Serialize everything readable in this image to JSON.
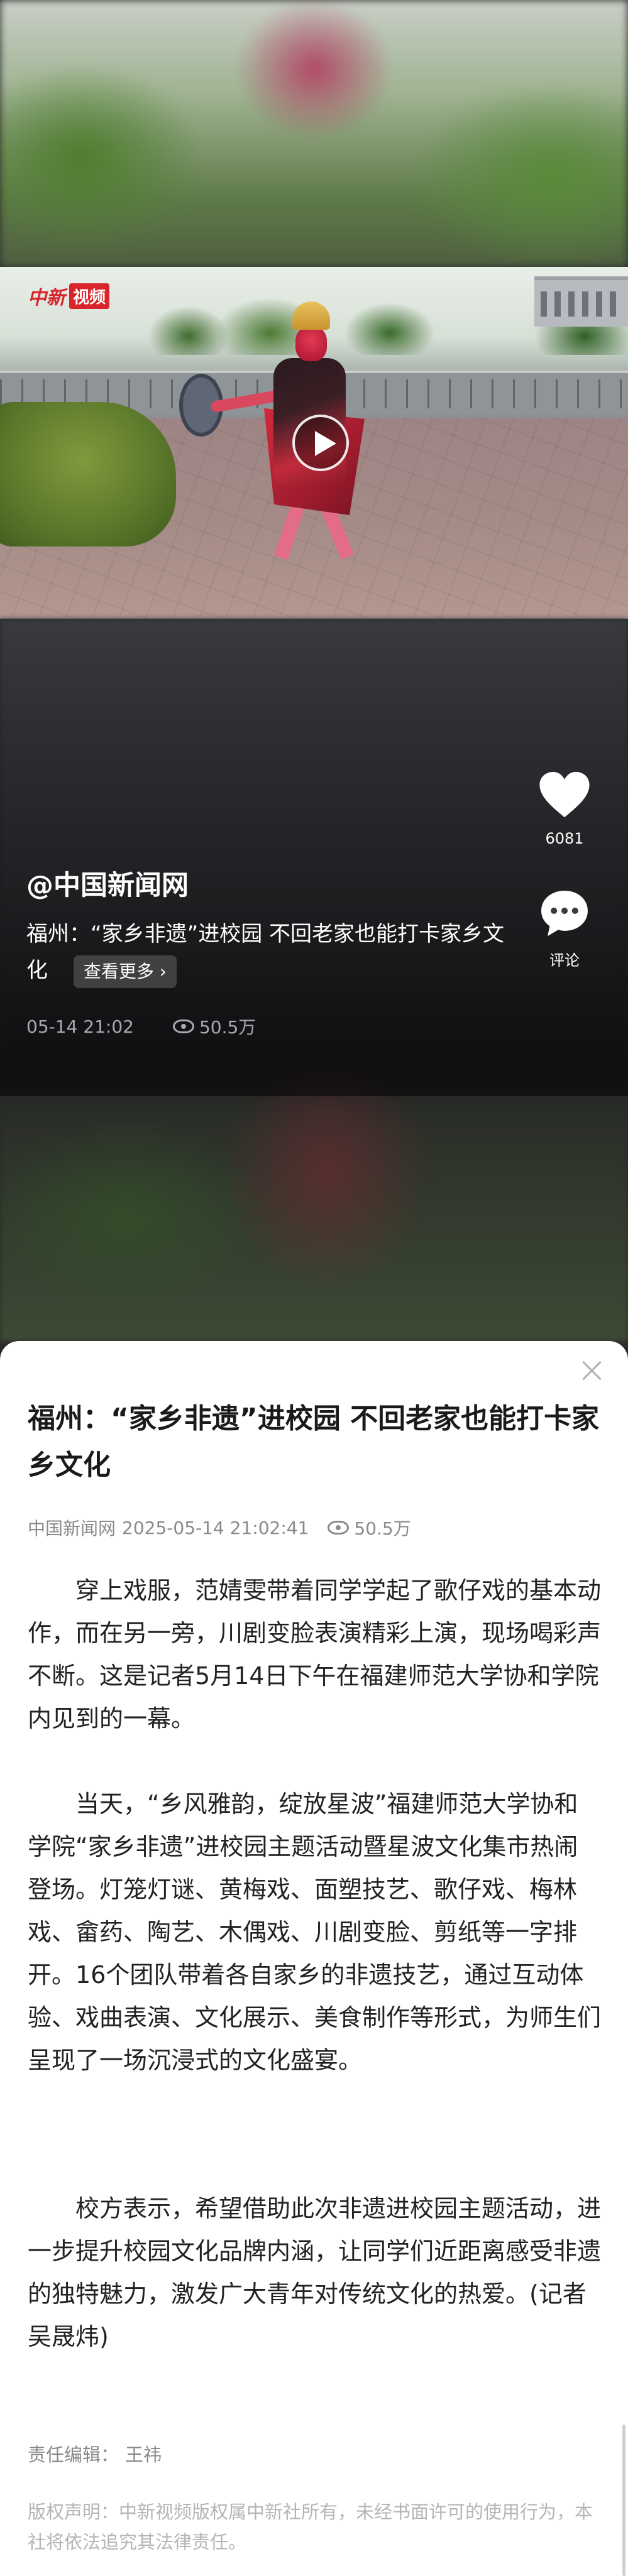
{
  "video": {
    "logo_brand": "中新",
    "logo_tag": "视频"
  },
  "overlay": {
    "author": "@中国新闻网",
    "caption": "福州：“家乡非遗”进校园 不回老家也能打卡家乡文化",
    "see_more": "查看更多 ›",
    "timestamp": "05-14 21:02",
    "views": "50.5万"
  },
  "actions": {
    "like_count": "6081",
    "comment_label": "评论"
  },
  "article": {
    "title": "福州：“家乡非遗”进校园 不回老家也能打卡家乡文化",
    "source": "中国新闻网",
    "datetime": "2025-05-14 21:02:41",
    "views": "50.5万",
    "paragraphs": [
      "穿上戏服，范婧雯带着同学学起了歌仔戏的基本动作，而在另一旁，川剧变脸表演精彩上演，现场喝彩声不断。这是记者5月14日下午在福建师范大学协和学院内见到的一幕。",
      "当天，“乡风雅韵，绽放星波”福建师范大学协和学院“家乡非遗”进校园主题活动暨星波文化集市热闹登场。灯笼灯谜、黄梅戏、面塑技艺、歌仔戏、梅林戏、畲药、陶艺、木偶戏、川剧变脸、剪纸等一字排开。16个团队带着各自家乡的非遗技艺，通过互动体验、戏曲表演、文化展示、美食制作等形式，为师生们呈现了一场沉浸式的文化盛宴。",
      "校方表示，希望借助此次非遗进校园主题活动，进一步提升校园文化品牌内涵，让同学们近距离感受非遗的独特魅力，激发广大青年对传统文化的热爱。(记者 吴晟炜)"
    ],
    "editor_label": "责任编辑：",
    "editor_name": "王祎",
    "copyright": "版权声明：中新视频版权属中新社所有，未经书面许可的使用行为，本社将依法追究其法律责任。"
  }
}
